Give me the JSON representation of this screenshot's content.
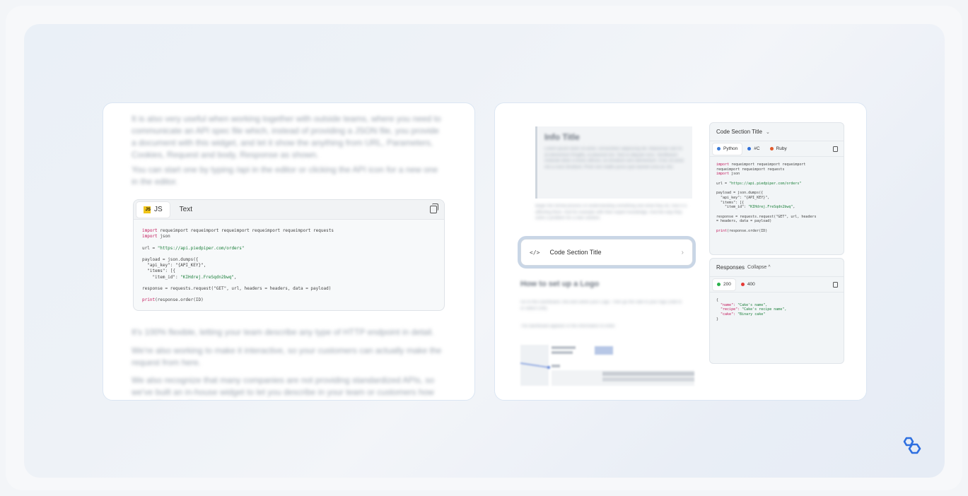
{
  "left_card": {
    "para1": "It is also very useful when working together with outside teams, where you need to communicate an API spec file which, instead of providing a JSON file, you provide a document with this widget, and let it show the anything from URL, Parameters, Cookies, Request and body, Response as shown.",
    "para2": "You can start one by typing /api in the editor or clicking the API icon for a new one in the editor.",
    "para3": "It's 100% flexible, letting your team describe any type of HTTP endpoint in detail.",
    "para4": "We're also working to make it interactive, so your customers can actually make the request from here.",
    "para5": "We also recognize that many companies are not providing standardized APIs, so we've built an in-house widget to let you describe in your team or customers how your API looks like.",
    "code_block": {
      "tabs": [
        {
          "label": "JS",
          "active": true
        },
        {
          "label": "Text",
          "active": false
        }
      ],
      "lines": [
        [
          {
            "t": "import ",
            "c": "kw"
          },
          {
            "t": "requeimport requeimport requeimport requeimport requeimport requests"
          }
        ],
        [
          {
            "t": "import ",
            "c": "kw"
          },
          {
            "t": "json"
          }
        ],
        [],
        [
          {
            "t": "url = "
          },
          {
            "t": "\"https://api.piedpiper.com/orders\"",
            "c": "str"
          }
        ],
        [],
        [
          {
            "t": "payload = json.dumps({"
          }
        ],
        [
          {
            "t": "  \"api_key\": \"{API_KEY}\","
          }
        ],
        [
          {
            "t": "  \"items\": [{"
          }
        ],
        [
          {
            "t": "    \"item_id\": "
          },
          {
            "t": "\"KIHdrej.FreSqdn2bwq\"",
            "c": "str"
          },
          {
            "t": ","
          }
        ],
        [],
        [
          {
            "t": "response = requests.request(\"GET\", url, headers = headers, data = payload)"
          }
        ],
        [],
        [
          {
            "t": "print",
            "c": "kw"
          },
          {
            "t": "(response.order(ID)"
          }
        ]
      ]
    }
  },
  "right_card": {
    "info_title": "Info Title",
    "info_text": "Lorem ipsum dolor sit amet, consectetur adipiscing elit. Maecenas sed mi at elementum fringilla, ut placerat nisi. Sed ut aliquam eros. Vestibulum molestie dolor a lorem ultrices, eu tincidunt sem elementum. Cras sit amet nisi a nunc tincidunt. Proin non mattis purus quis laoreet urna ac nisi.",
    "para1": "Begin the formal process of understanding something and what they do, how it is affecting them. And for example with their expert knowledge. And the way they solve a problem for a new solution.",
    "section_title": "Code Section Title",
    "how_title": "How to set up a Logo",
    "para2": "Go to the Dashboard, find and select your Logo. Then go the side to your logo (Add to or select Link).",
    "para3": "The dashboard appears in the information to enter.",
    "code_panel": {
      "title": "Code Section Title",
      "tabs": [
        {
          "label": "Python",
          "color": "#3b7bd6",
          "active": true
        },
        {
          "label": "#C",
          "color": "#2f6fd8",
          "active": false
        },
        {
          "label": "Ruby",
          "color": "#e0592a",
          "active": false
        }
      ],
      "lines": [
        [
          {
            "t": "import ",
            "c": "kw"
          },
          {
            "t": "requeimport requeimport requeimport"
          }
        ],
        [
          {
            "t": "requeimport requeimport requests"
          }
        ],
        [
          {
            "t": "import ",
            "c": "kw"
          },
          {
            "t": "json"
          }
        ],
        [],
        [
          {
            "t": "url = "
          },
          {
            "t": "\"https://api.piedpiper.com/orders\"",
            "c": "str"
          }
        ],
        [],
        [
          {
            "t": "payload = json.dumps({"
          }
        ],
        [
          {
            "t": "  \"api_key\": \"{API_KEY}\","
          }
        ],
        [
          {
            "t": "  \"items\": [{"
          }
        ],
        [
          {
            "t": "    \"item_id\": "
          },
          {
            "t": "\"KIHdrej.FreSqdn2bwq\"",
            "c": "str"
          },
          {
            "t": ","
          }
        ],
        [],
        [
          {
            "t": "response = requests.request(\"GET\", url, headers"
          }
        ],
        [
          {
            "t": "= headers, data = payload)"
          }
        ],
        [],
        [
          {
            "t": "print",
            "c": "kw"
          },
          {
            "t": "(response.order(ID)"
          }
        ]
      ]
    },
    "responses_panel": {
      "title": "Responses",
      "collapse_label": "Collapse",
      "tabs": [
        {
          "label": "200",
          "color": "#2bb24c",
          "active": true
        },
        {
          "label": "400",
          "color": "#e53935",
          "active": false
        }
      ],
      "lines": [
        [
          {
            "t": "{"
          }
        ],
        [
          {
            "t": "  \"name\": ",
            "c": "kw"
          },
          {
            "t": "\"Cake's name\",",
            "c": "str"
          }
        ],
        [
          {
            "t": "  \"recipe\": ",
            "c": "kw"
          },
          {
            "t": "\"Cake's recipe name\",",
            "c": "str"
          }
        ],
        [
          {
            "t": "  \"cake\": ",
            "c": "kw"
          },
          {
            "t": "\"Binary cake\"",
            "c": "str"
          }
        ],
        [
          {
            "t": "}"
          }
        ]
      ]
    }
  },
  "colors": {
    "accent_logo": "#2e6fe0",
    "keyword": "#c2185b",
    "string": "#1b7f3a"
  }
}
